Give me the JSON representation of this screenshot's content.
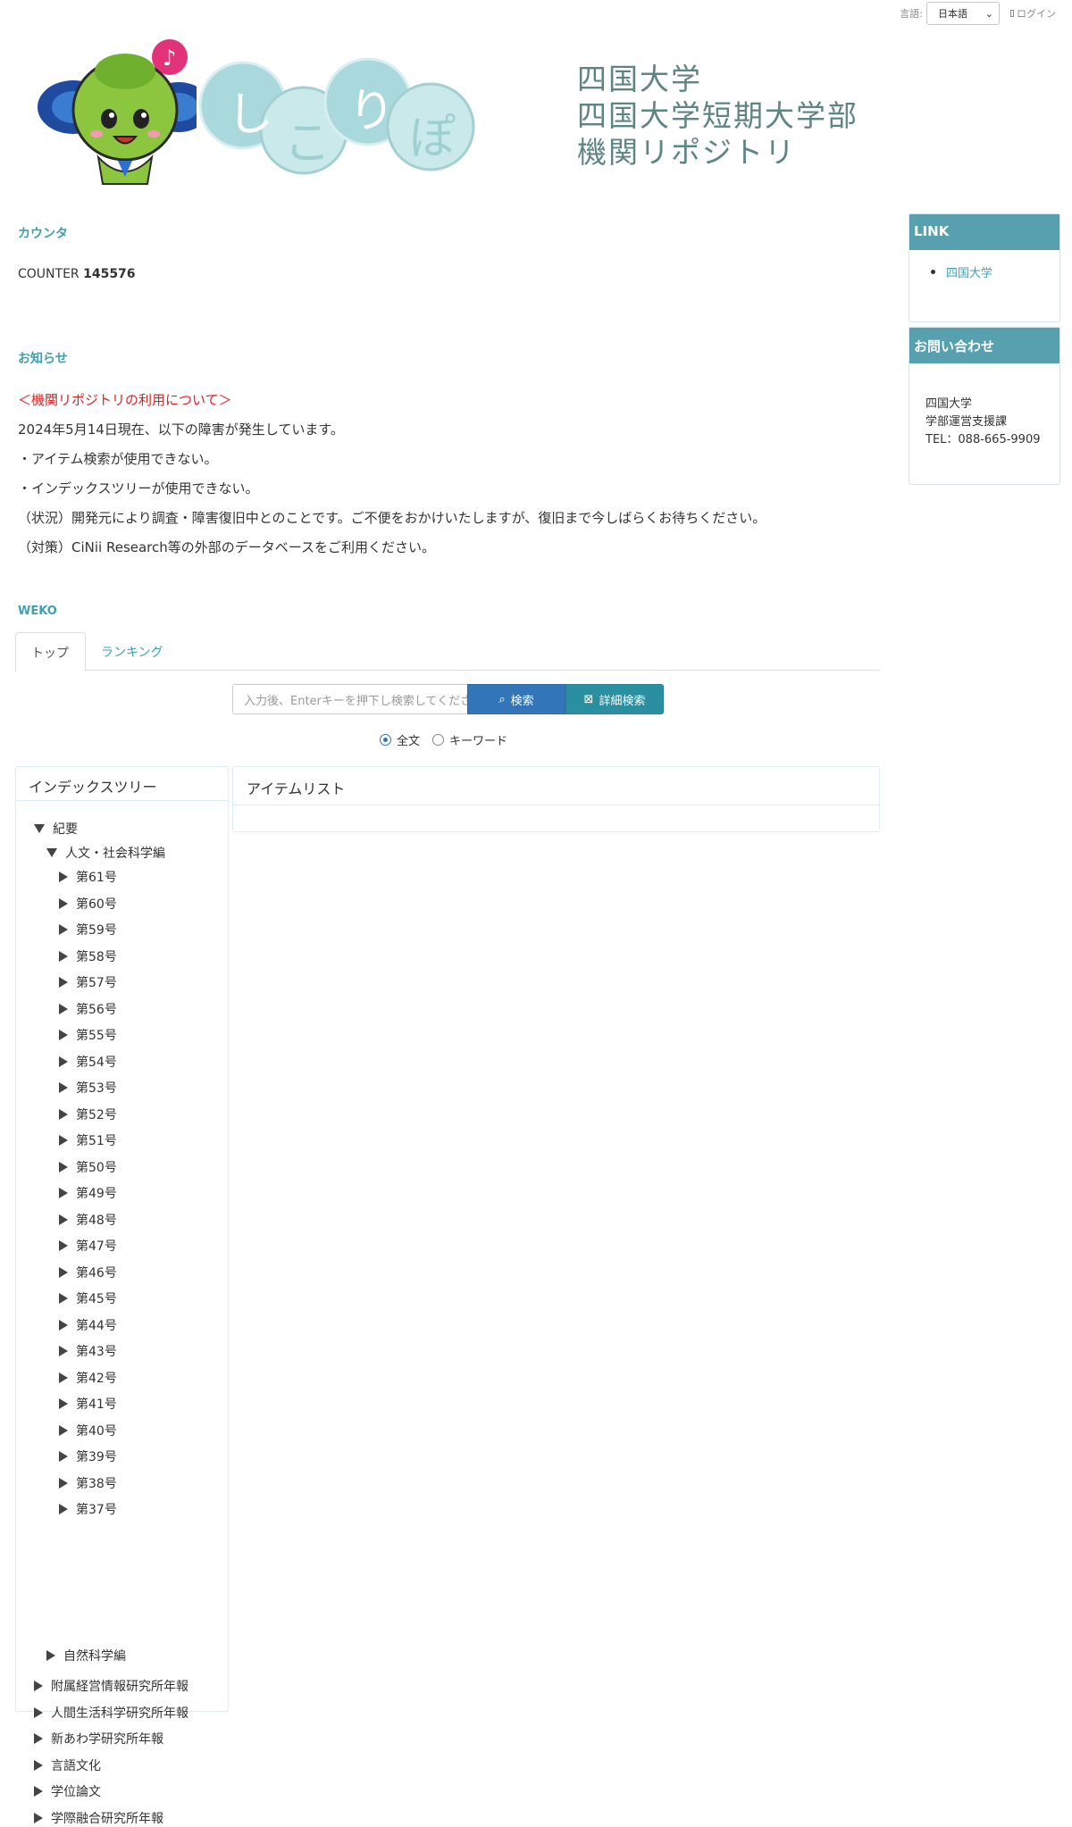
{
  "topbar": {
    "lang_label": "言語:",
    "lang_value": "日本語",
    "login": "ログイン"
  },
  "header": {
    "logo_chars": [
      "し",
      "こ",
      "り",
      "ぽ"
    ],
    "names": [
      "四国大学",
      "四国大学短期大学部",
      "機関リポジトリ"
    ]
  },
  "counter": {
    "section_title": "カウンタ",
    "label": "COUNTER",
    "value": "145576"
  },
  "notice": {
    "section_title": "お知らせ",
    "heading": "＜機関リポジトリの利用について＞",
    "lines": [
      "2024年5月14日現在、以下の障害が発生しています。",
      "・アイテム検索が使用できない。",
      "・インデックスツリーが使用できない。",
      "（状況）開発元により調査・障害復旧中とのことです。ご不便をおかけいたしますが、復旧まで今しばらくお待ちください。",
      "（対策）CiNii Research等の外部のデータベースをご利用ください。"
    ]
  },
  "weko": {
    "section_title": "WEKO",
    "tabs": [
      "トップ",
      "ランキング"
    ],
    "search": {
      "placeholder": "入力後、Enterキーを押下し検索してください",
      "search_button": "検索",
      "detail_button": "詳細検索",
      "radio_fulltext": "全文",
      "radio_keyword": "キーワード",
      "selected": "全文"
    }
  },
  "index_tree": {
    "title": "インデックスツリー",
    "root": "紀要",
    "humanities": "人文・社会科学編",
    "volumes": [
      "第61号",
      "第60号",
      "第59号",
      "第58号",
      "第57号",
      "第56号",
      "第55号",
      "第54号",
      "第53号",
      "第52号",
      "第51号",
      "第50号",
      "第49号",
      "第48号",
      "第47号",
      "第46号",
      "第45号",
      "第44号",
      "第43号",
      "第42号",
      "第41号",
      "第40号",
      "第39号",
      "第38号",
      "第37号"
    ],
    "science": "自然科学編",
    "others": [
      "附属経営情報研究所年報",
      "人間生活科学研究所年報",
      "新あわ学研究所年報",
      "言語文化",
      "学位論文",
      "学際融合研究所年報"
    ]
  },
  "item_list": {
    "title": "アイテムリスト"
  },
  "sidebar": {
    "link_box": {
      "title": "LINK",
      "items": [
        "四国大学"
      ]
    },
    "contact_box": {
      "title": "お問い合わせ",
      "lines": [
        "四国大学",
        "学部運営支援課",
        "TEL：088-665-9909"
      ]
    }
  },
  "colors": {
    "accent": "#3fa0b5",
    "side_header": "#56a0b0",
    "search_button": "#3375b9",
    "detail_button": "#2a8fa0",
    "notice_red": "#e02020"
  }
}
